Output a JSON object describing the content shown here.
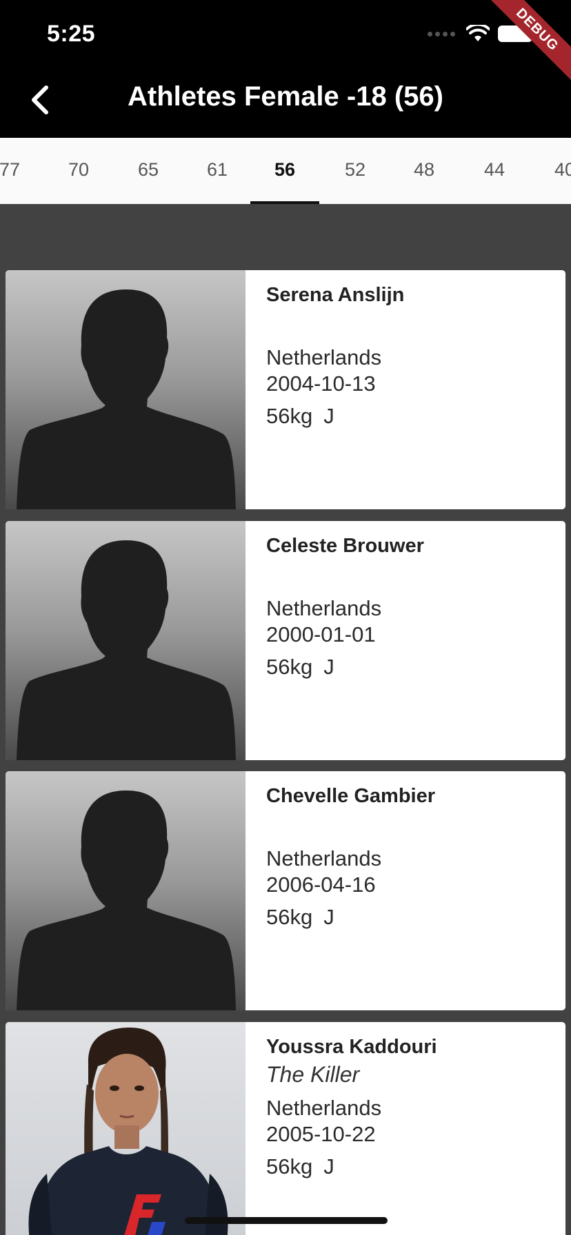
{
  "status_bar": {
    "time": "5:25",
    "debug_label": "DEBUG"
  },
  "app_bar": {
    "title": "Athletes Female -18 (56)",
    "back_icon": "chevron-left-icon"
  },
  "tabs": {
    "items": [
      "77",
      "70",
      "65",
      "61",
      "56",
      "52",
      "48",
      "44",
      "40"
    ],
    "active": "56"
  },
  "athletes": [
    {
      "name": "Serena Anslijn",
      "nickname": "",
      "country": "Netherlands",
      "dob": "2004-10-13",
      "weight": "56kg",
      "category": "J",
      "photo": "placeholder-silhouette"
    },
    {
      "name": "Celeste Brouwer",
      "nickname": "",
      "country": "Netherlands",
      "dob": "2000-01-01",
      "weight": "56kg",
      "category": "J",
      "photo": "placeholder-silhouette"
    },
    {
      "name": "Chevelle Gambier",
      "nickname": "",
      "country": "Netherlands",
      "dob": "2006-04-16",
      "weight": "56kg",
      "category": "J",
      "photo": "placeholder-silhouette"
    },
    {
      "name": "Youssra Kaddouri",
      "nickname": "The Killer",
      "country": "Netherlands",
      "dob": "2005-10-22",
      "weight": "56kg",
      "category": "J",
      "photo": "athlete-photo"
    }
  ],
  "colors": {
    "app_bar": "#000000",
    "tab_bar": "#fafafa",
    "background": "#424242",
    "debug_ribbon": "#a4262c"
  }
}
